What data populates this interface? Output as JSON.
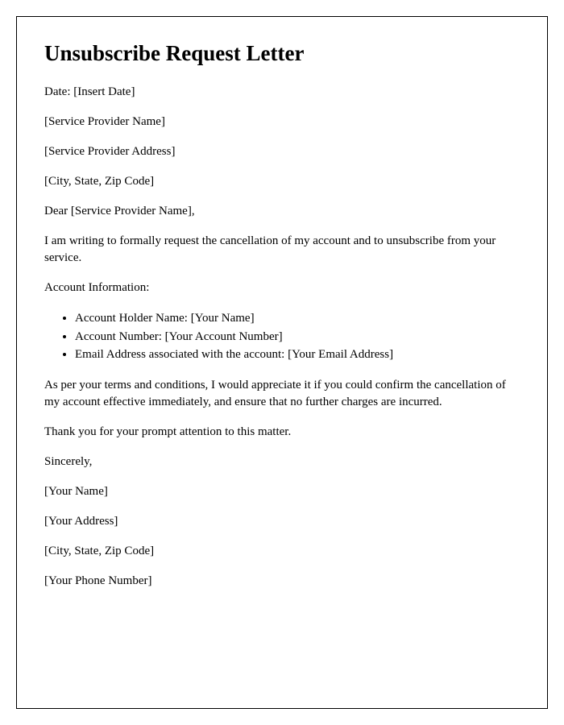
{
  "title": "Unsubscribe Request Letter",
  "lines": {
    "date": "Date: [Insert Date]",
    "provider_name": "[Service Provider Name]",
    "provider_address": "[Service Provider Address]",
    "provider_city": "[City, State, Zip Code]",
    "salutation": "Dear [Service Provider Name],",
    "intro": "I am writing to formally request the cancellation of my account and to unsubscribe from your service.",
    "account_info_label": "Account Information:",
    "bullets": [
      "Account Holder Name: [Your Name]",
      "Account Number: [Your Account Number]",
      "Email Address associated with the account: [Your Email Address]"
    ],
    "terms": "As per your terms and conditions, I would appreciate it if you could confirm the cancellation of my account effective immediately, and ensure that no further charges are incurred.",
    "thanks": "Thank you for your prompt attention to this matter.",
    "closing": "Sincerely,",
    "your_name": "[Your Name]",
    "your_address": "[Your Address]",
    "your_city": "[City, State, Zip Code]",
    "your_phone": "[Your Phone Number]"
  }
}
